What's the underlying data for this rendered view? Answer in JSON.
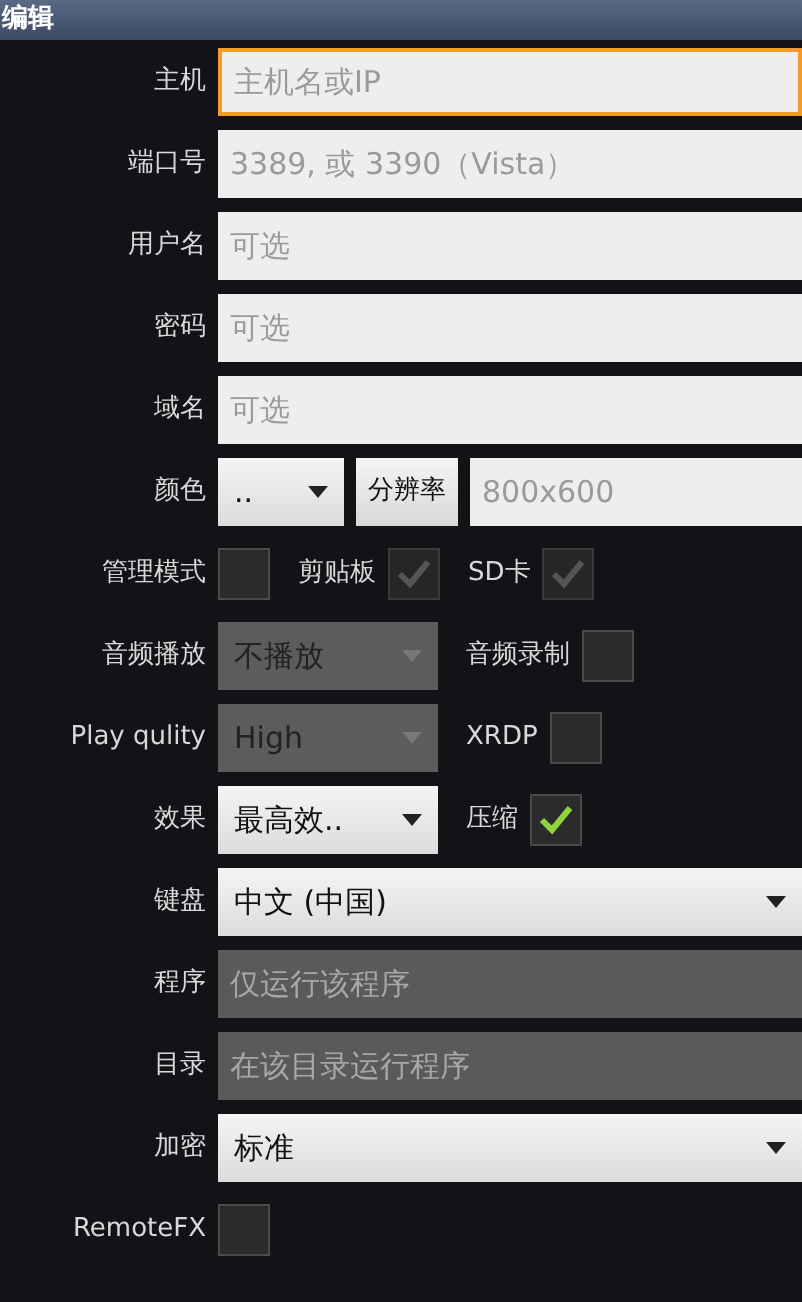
{
  "window": {
    "title": "编辑"
  },
  "rows": [
    {
      "label": "主机",
      "controls": [
        {
          "kind": "input",
          "placeholder": "主机名或IP",
          "focused": true,
          "disabled": false
        }
      ]
    },
    {
      "label": "端口号",
      "controls": [
        {
          "kind": "input",
          "placeholder": "3389, 或 3390（Vista）",
          "focused": false,
          "disabled": false
        }
      ]
    },
    {
      "label": "用户名",
      "controls": [
        {
          "kind": "input",
          "placeholder": "可选",
          "focused": false,
          "disabled": false
        }
      ]
    },
    {
      "label": "密码",
      "controls": [
        {
          "kind": "input",
          "placeholder": "可选",
          "focused": false,
          "disabled": false
        }
      ]
    },
    {
      "label": "域名",
      "controls": [
        {
          "kind": "input",
          "placeholder": "可选",
          "focused": false,
          "disabled": false
        }
      ]
    },
    {
      "label": "颜色",
      "controls": [
        {
          "kind": "select",
          "value": "..",
          "disabled": false
        },
        {
          "kind": "button",
          "text": "分辨率"
        },
        {
          "kind": "input",
          "placeholder": "800x600",
          "focused": false,
          "disabled": false
        }
      ]
    },
    {
      "label": "管理模式",
      "controls": [
        {
          "kind": "checkbox",
          "checked": false,
          "disabled": false
        },
        {
          "kind": "label",
          "text": "剪贴板"
        },
        {
          "kind": "checkbox",
          "checked": true,
          "disabled": true
        },
        {
          "kind": "label",
          "text": "SD卡"
        },
        {
          "kind": "checkbox",
          "checked": true,
          "disabled": true
        }
      ]
    },
    {
      "label": "音频播放",
      "controls": [
        {
          "kind": "select",
          "value": "不播放",
          "disabled": true
        },
        {
          "kind": "label",
          "text": "音频录制"
        },
        {
          "kind": "checkbox",
          "checked": false,
          "disabled": false
        }
      ]
    },
    {
      "label": "Play qulity",
      "controls": [
        {
          "kind": "select",
          "value": "High",
          "disabled": true
        },
        {
          "kind": "label",
          "text": "XRDP"
        },
        {
          "kind": "checkbox",
          "checked": false,
          "disabled": false
        }
      ]
    },
    {
      "label": "效果",
      "controls": [
        {
          "kind": "select",
          "value": "最高效..",
          "disabled": false
        },
        {
          "kind": "label",
          "text": "压缩"
        },
        {
          "kind": "checkbox",
          "checked": true,
          "disabled": false
        }
      ]
    },
    {
      "label": "键盘",
      "controls": [
        {
          "kind": "select",
          "value": "中文 (中国)",
          "disabled": false
        }
      ]
    },
    {
      "label": "程序",
      "controls": [
        {
          "kind": "input",
          "placeholder": "仅运行该程序",
          "focused": false,
          "disabled": true
        }
      ]
    },
    {
      "label": "目录",
      "controls": [
        {
          "kind": "input",
          "placeholder": "在该目录运行程序",
          "focused": false,
          "disabled": true
        }
      ]
    },
    {
      "label": "加密",
      "controls": [
        {
          "kind": "select",
          "value": "标准",
          "disabled": false
        }
      ]
    },
    {
      "label": "RemoteFX",
      "controls": [
        {
          "kind": "checkbox",
          "checked": false,
          "disabled": false
        }
      ]
    }
  ]
}
